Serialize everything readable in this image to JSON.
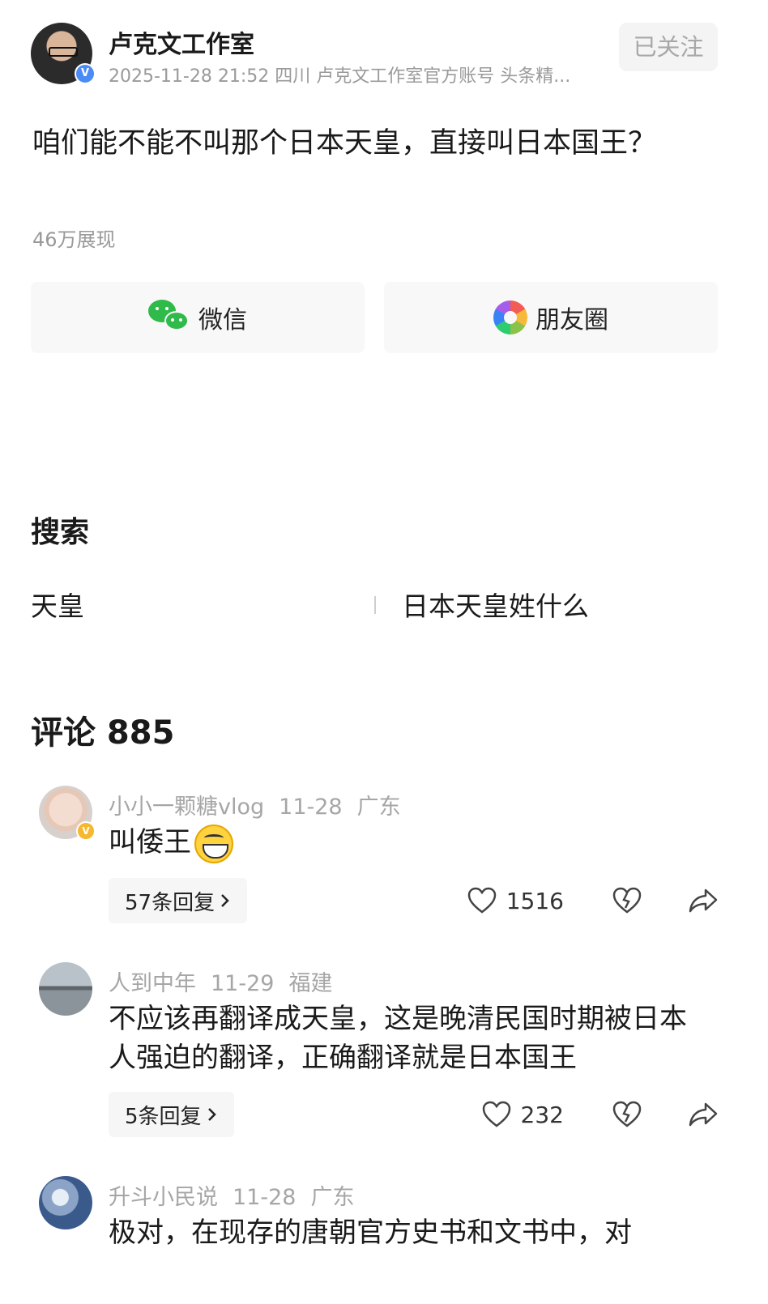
{
  "author": {
    "name": "卢克文工作室",
    "meta": "2025-11-28 21:52 四川 卢克文工作室官方账号 头条精...",
    "verified_badge": "V",
    "follow_label": "已关注"
  },
  "post": {
    "text": "咱们能不能不叫那个日本天皇，直接叫日本国王？",
    "views": "46万展现"
  },
  "share": {
    "wechat_label": "微信",
    "moments_label": "朋友圈"
  },
  "search": {
    "title": "搜索",
    "items": [
      "天皇",
      "日本天皇姓什么"
    ]
  },
  "comments": {
    "title": "评论 885",
    "list": [
      {
        "user": "小小一颗糖vlog",
        "date": "11-28",
        "location": "广东",
        "text": "叫倭王",
        "replies": "57条回复",
        "likes": "1516",
        "badge": "V"
      },
      {
        "user": "人到中年",
        "date": "11-29",
        "location": "福建",
        "text": "不应该再翻译成天皇，这是晚清民国时期被日本人强迫的翻译，正确翻译就是日本国王",
        "replies": "5条回复",
        "likes": "232"
      },
      {
        "user": "升斗小民说",
        "date": "11-28",
        "location": "广东",
        "text": "极对，在现存的唐朝官方史书和文书中，对"
      }
    ]
  },
  "colors": {
    "wechat_green": "#2fba4a",
    "verify_blue": "#4a8bf5",
    "verify_gold": "#f5b82e",
    "meta_gray": "#9a9a9a"
  }
}
